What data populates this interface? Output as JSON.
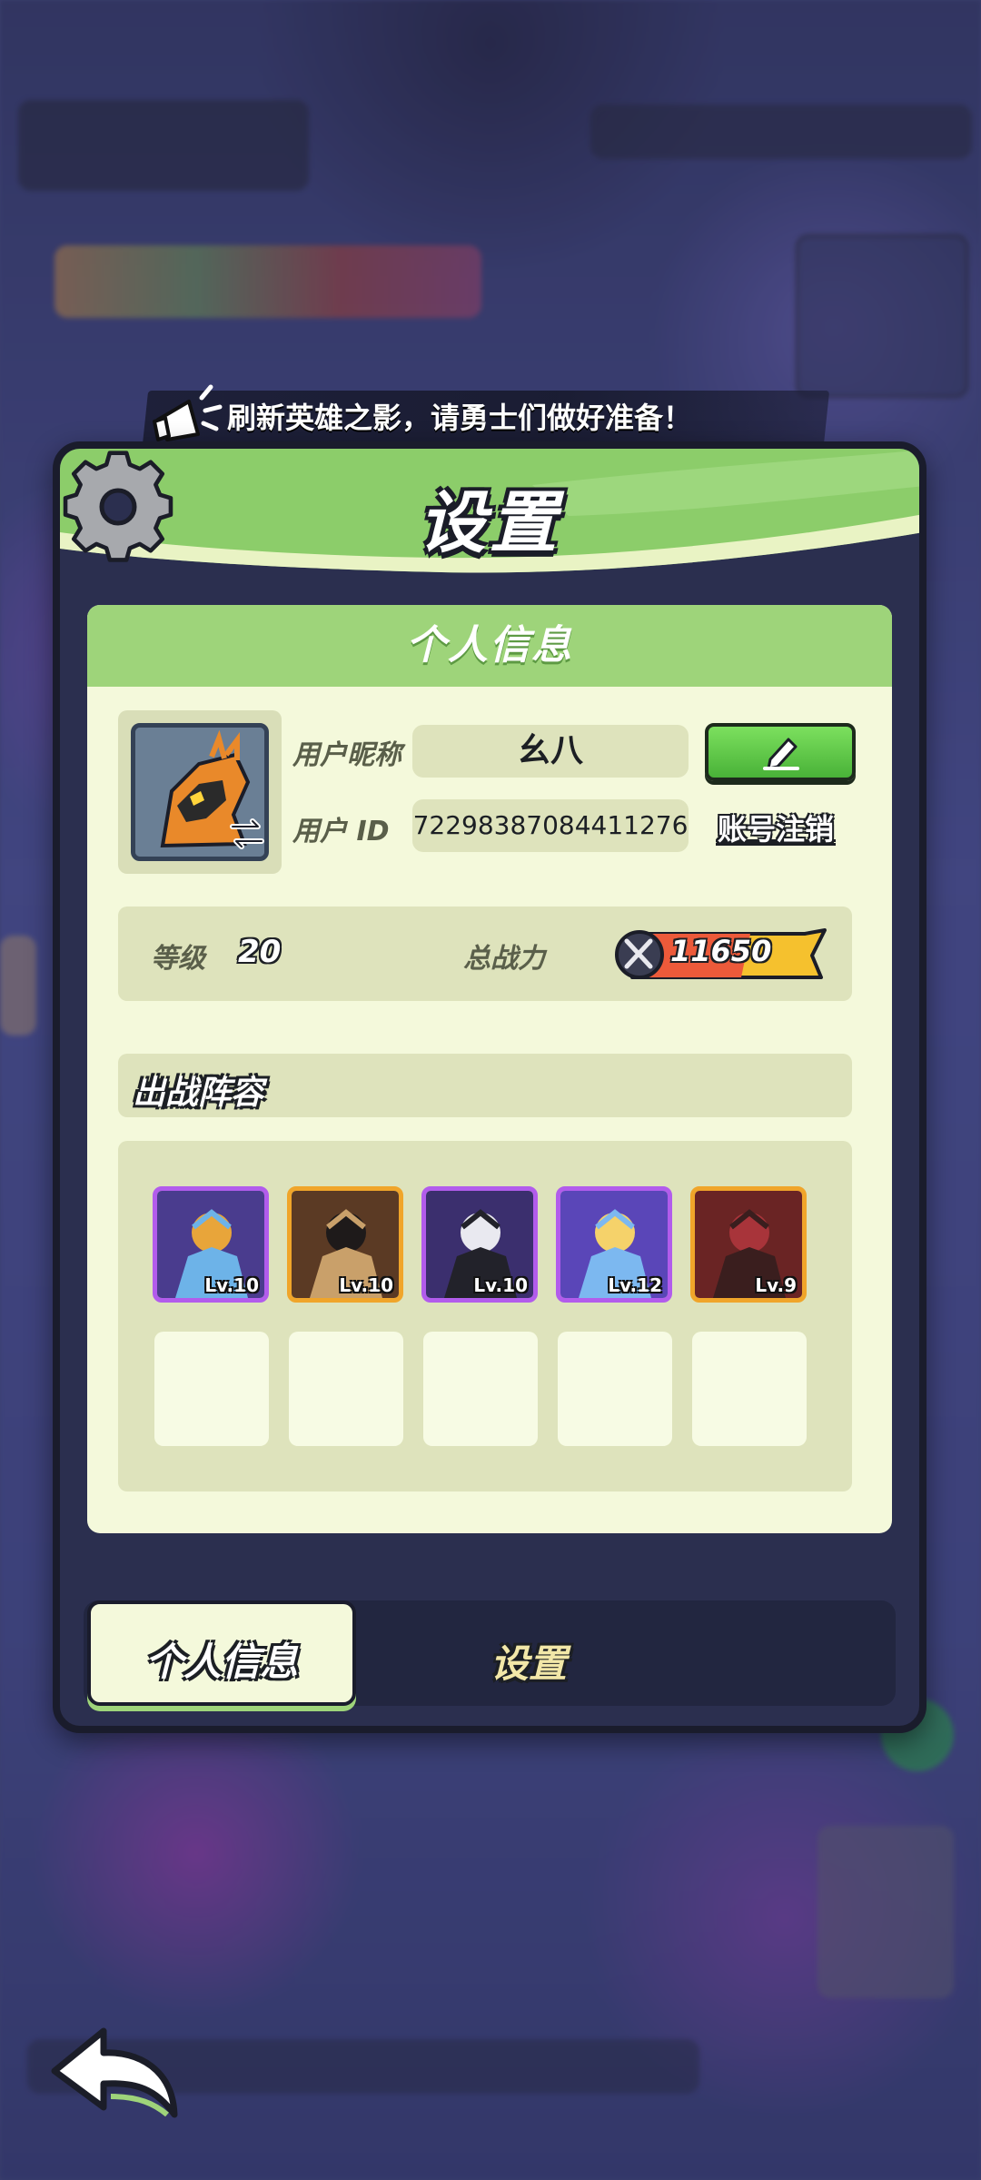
{
  "announcement": {
    "text": "刷新英雄之影，请勇士们做好准备！"
  },
  "dialog": {
    "title": "设置",
    "panel_title": "个人信息"
  },
  "profile": {
    "nickname_label": "用户昵称",
    "nickname_value": "幺八",
    "id_label": "用户 ID",
    "id_value": "72298387084411276",
    "account_cancel_link": "账号注销"
  },
  "stats": {
    "level_label": "等级",
    "level_value": "20",
    "power_label": "总战力",
    "power_value": "11650"
  },
  "lineup": {
    "title": "出战阵容",
    "heroes": [
      {
        "level": "Lv.10",
        "rarity": "purple",
        "colors": [
          "#4a3c8e",
          "#e8a53a",
          "#6db3e8"
        ]
      },
      {
        "level": "Lv.10",
        "rarity": "gold",
        "colors": [
          "#5b3a24",
          "#1e1a1a",
          "#c9a06a"
        ]
      },
      {
        "level": "Lv.10",
        "rarity": "purple",
        "colors": [
          "#3b2f6e",
          "#e9e9f0",
          "#22222a"
        ]
      },
      {
        "level": "Lv.12",
        "rarity": "purple",
        "colors": [
          "#5a46b8",
          "#f5d26a",
          "#7cb8f0"
        ]
      },
      {
        "level": "Lv.9",
        "rarity": "gold",
        "colors": [
          "#6a2424",
          "#a8343a",
          "#3a1e1e"
        ]
      }
    ],
    "empty_slots": 5
  },
  "tabs": {
    "active": "个人信息",
    "inactive": "设置"
  },
  "colors": {
    "panel_bg": "#f4f9db",
    "header_green": "#9ed47a",
    "edit_green": "#49b238",
    "dialog_dark": "#2b2f4f",
    "rarity_purple": "#b25cec",
    "rarity_gold": "#f0a52a"
  },
  "icons": {
    "announcement": "horn-icon",
    "dialog": "gear-icon",
    "edit": "pencil-icon",
    "avatar_switch": "swap-icon",
    "power": "sword-icon",
    "back": "back-arrow-icon"
  }
}
